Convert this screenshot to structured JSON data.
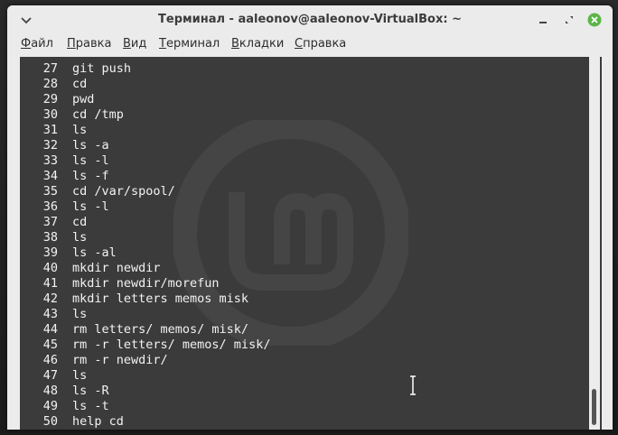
{
  "window": {
    "title": "Терминал - aaleonov@aaleonov-VirtualBox: ~"
  },
  "menu": [
    {
      "label_acc": "Ф",
      "label_rest": "айл",
      "icon": ""
    },
    {
      "label_acc": "П",
      "label_rest": "равка"
    },
    {
      "label_acc": "В",
      "label_rest": "ид"
    },
    {
      "label_acc": "Т",
      "label_rest": "ерминал"
    },
    {
      "label_acc": "В",
      "label_rest": "кладки"
    },
    {
      "label_acc": "С",
      "label_rest": "правка"
    }
  ],
  "history": [
    {
      "n": "27",
      "cmd": "git push"
    },
    {
      "n": "28",
      "cmd": "cd"
    },
    {
      "n": "29",
      "cmd": "pwd"
    },
    {
      "n": "30",
      "cmd": "cd /tmp"
    },
    {
      "n": "31",
      "cmd": "ls"
    },
    {
      "n": "32",
      "cmd": "ls -a"
    },
    {
      "n": "33",
      "cmd": "ls -l"
    },
    {
      "n": "34",
      "cmd": "ls -f"
    },
    {
      "n": "35",
      "cmd": "cd /var/spool/"
    },
    {
      "n": "36",
      "cmd": "ls -l"
    },
    {
      "n": "37",
      "cmd": "cd"
    },
    {
      "n": "38",
      "cmd": "ls"
    },
    {
      "n": "39",
      "cmd": "ls -al"
    },
    {
      "n": "40",
      "cmd": "mkdir newdir"
    },
    {
      "n": "41",
      "cmd": "mkdir newdir/morefun"
    },
    {
      "n": "42",
      "cmd": "mkdir letters memos misk"
    },
    {
      "n": "43",
      "cmd": "ls"
    },
    {
      "n": "44",
      "cmd": "rm letters/ memos/ misk/"
    },
    {
      "n": "45",
      "cmd": "rm -r letters/ memos/ misk/"
    },
    {
      "n": "46",
      "cmd": "rm -r newdir/"
    },
    {
      "n": "47",
      "cmd": "ls"
    },
    {
      "n": "48",
      "cmd": "ls -R"
    },
    {
      "n": "49",
      "cmd": "ls -t"
    },
    {
      "n": "50",
      "cmd": "help cd"
    }
  ],
  "colors": {
    "terminal_bg": "#3b3b3b",
    "terminal_fg": "#f2f2f2",
    "close_button": "#5db548"
  }
}
